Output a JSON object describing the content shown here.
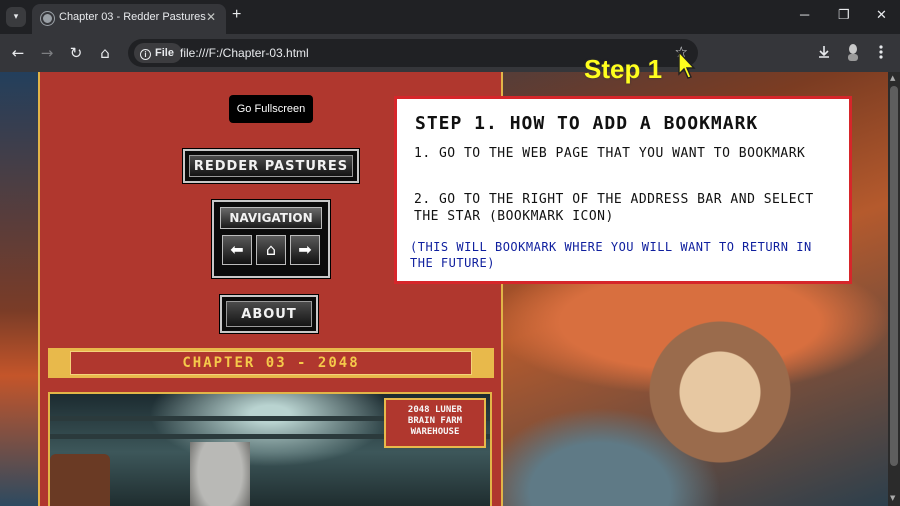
{
  "browser": {
    "tab": {
      "title": "Chapter 03 - Redder Pastures",
      "close": "✕"
    },
    "new_tab": "+",
    "window": {
      "minimize": "─",
      "restore": "❐",
      "close": "✕"
    },
    "toolbar": {
      "back": "←",
      "forward": "→",
      "reload": "↻",
      "home": "⌂",
      "chip_label": "File",
      "url": "file:///F:/Chapter-03.html",
      "bookmark_star": "☆"
    }
  },
  "page": {
    "fullscreen_button": "Go Fullscreen",
    "title_plate": "REDDER PASTURES",
    "navigation": {
      "title": "NAVIGATION",
      "back_arrow": "⬅",
      "home": "⌂",
      "forward_arrow": "➡"
    },
    "about_button": "ABOUT",
    "chapter_banner": "CHAPTER 03 - 2048",
    "image_sign": [
      "2048 LUNER",
      "BRAIN FARM",
      "WAREHOUSE"
    ]
  },
  "instruction": {
    "step_label": "Step 1",
    "title": "STEP 1. HOW TO ADD A BOOKMARK",
    "line1": "1. GO TO THE WEB PAGE THAT YOU WANT TO BOOKMARK",
    "line2": "2. GO TO THE RIGHT OF THE ADDRESS BAR AND SELECT THE STAR (BOOKMARK ICON)",
    "note": "(THIS WILL BOOKMARK WHERE YOU WILL WANT TO RETURN IN THE FUTURE)"
  },
  "colors": {
    "page_red": "#b0372e",
    "gold": "#e2b548",
    "callout_border": "#d6262a",
    "note_blue": "#0f1f9e",
    "step_yellow": "#ffff1e"
  },
  "icons": [
    "tab-list-icon",
    "globe-icon",
    "info-icon",
    "star-icon",
    "download-icon",
    "profile-icon",
    "kebab-menu-icon",
    "home-icon",
    "arrow-left-icon",
    "arrow-right-icon",
    "mouse-pointer-icon"
  ]
}
